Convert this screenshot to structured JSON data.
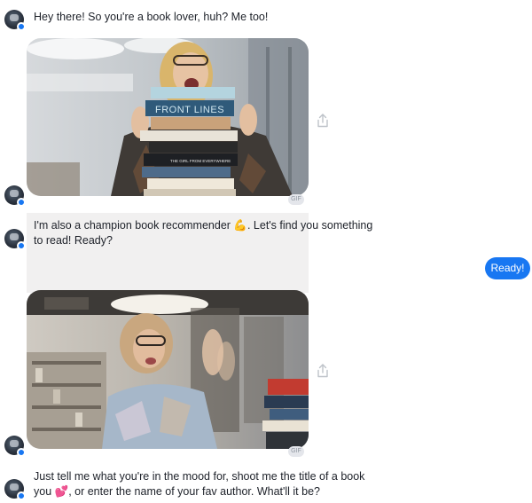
{
  "messages": [
    {
      "id": "m1",
      "text": "Hey there! So you're a book lover, huh?  Me too!"
    },
    {
      "id": "m2",
      "line1": "I'm also a champion book recommender 💪. Let's find you something",
      "line2": "to read! Ready?"
    },
    {
      "id": "m3",
      "line1": "Just tell me what you're in the mood for, shoot me the title of a book",
      "line2": "you 💕, or enter the name of your fav author. What'll it be?"
    }
  ],
  "gif1": {
    "book_titles": [
      "FRONT LINES",
      "THE GIRL FROM EVERYWHERE"
    ],
    "label": "GIF"
  },
  "gif2": {
    "label": "GIF"
  },
  "quick_reply": {
    "label": "Ready!"
  },
  "icons": {
    "avatar": "bot-avatar-icon",
    "share": "share-icon",
    "badge": "messenger-badge-icon"
  },
  "colors": {
    "accent": "#1877f2",
    "bubble": "#f1f0f0",
    "text": "#1d2129"
  }
}
